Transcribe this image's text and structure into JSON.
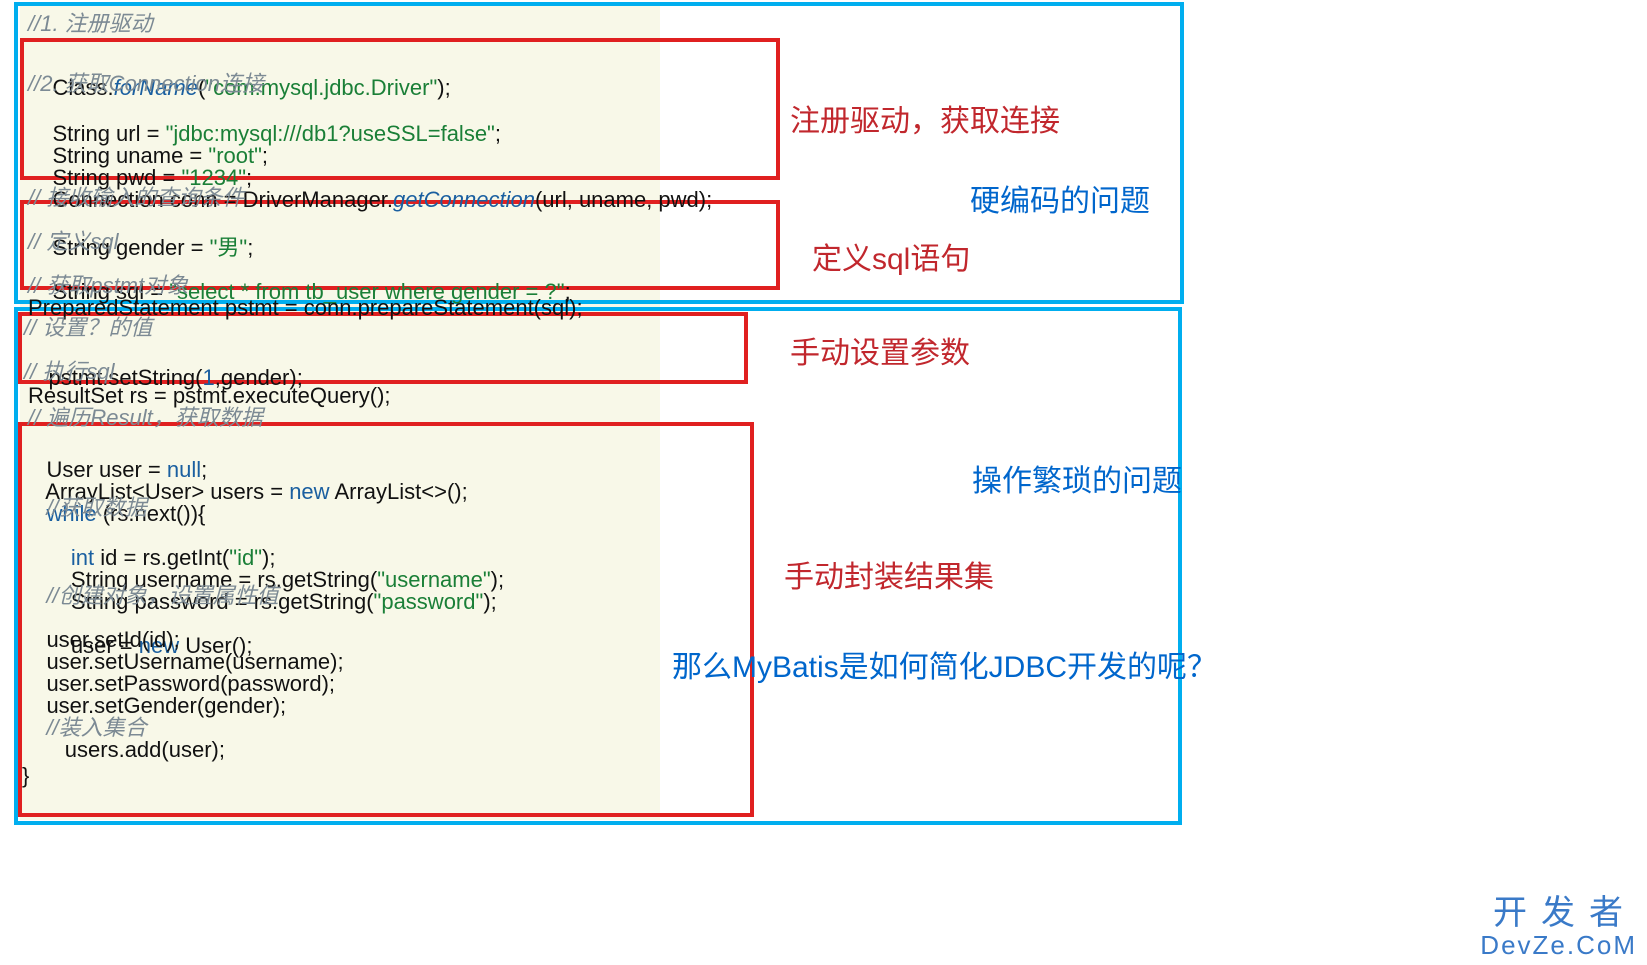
{
  "code": {
    "c01": "//1. 注册驱动",
    "c02a": "Class.",
    "c02b": "forName",
    "c02c": "(",
    "c02d": "\"com.mysql.jdbc.Driver\"",
    "c02e": ");",
    "c03": "//2. 获取Connection连接",
    "c04a": "String url = ",
    "c04b": "\"jdbc:mysql:///db1?useSSL=false\"",
    "c04c": ";",
    "c05a": "String uname = ",
    "c05b": "\"root\"",
    "c05c": ";",
    "c06a": "String pwd = ",
    "c06b": "\"1234\"",
    "c06c": ";",
    "c07a": "Connection conn = DriverManager.",
    "c07b": "getConnection",
    "c07c": "(url, uname, pwd);",
    "c08": "// 接收输入的查询条件",
    "c09a": "String gender = ",
    "c09b": "\"男\"",
    "c09c": ";",
    "c10": "// 定义sql",
    "c11a": "String sql = ",
    "c11b": "\"select * from tb_user where gender = ?\"",
    "c11c": ";",
    "c12": "// 获取pstmt对象",
    "c13": "PreparedStatement pstmt = conn.prepareStatement(sql);",
    "c14": "// 设置？的值",
    "c15a": "pstmt.setString(",
    "c15b": "1",
    "c15c": ",gender);",
    "c16": "// 执行sql",
    "c17": "ResultSet rs = pstmt.executeQuery();",
    "c18": "// 遍历Result，获取数据",
    "c19a": "User user = ",
    "c19b": "null",
    "c19c": ";",
    "c20a": "ArrayList<User> users = ",
    "c20b": "new",
    "c20c": " ArrayList<>();",
    "c21a": "while",
    "c21b": " (rs.next()){",
    "c22": "    //获取数据",
    "c23a": "    int",
    "c23b": " id = rs.getInt(",
    "c23c": "\"id\"",
    "c23d": ");",
    "c24a": "    String username = rs.getString(",
    "c24b": "\"username\"",
    "c24c": ");",
    "c25a": "    String password = rs.getString(",
    "c25b": "\"password\"",
    "c25c": ");",
    "c26": "    //创建对象，设置属性值",
    "c27a": "    user = ",
    "c27b": "new",
    "c27c": " User();",
    "c28": "    user.setId(id);",
    "c29": "    user.setUsername(username);",
    "c30": "    user.setPassword(password);",
    "c31": "    user.setGender(gender);",
    "c32": "    //装入集合",
    "c33": "       users.add(user);",
    "c34": "}"
  },
  "annotations": {
    "a1": "注册驱动，获取连接",
    "a2": "硬编码的问题",
    "a3": "定义sql语句",
    "a4": "手动设置参数",
    "a5": "操作繁琐的问题",
    "a6": "手动封装结果集",
    "a7": "那么MyBatis是如何简化JDBC开发的呢？"
  },
  "watermark": {
    "cn": "开发者",
    "en": "DevZe.CoM"
  }
}
